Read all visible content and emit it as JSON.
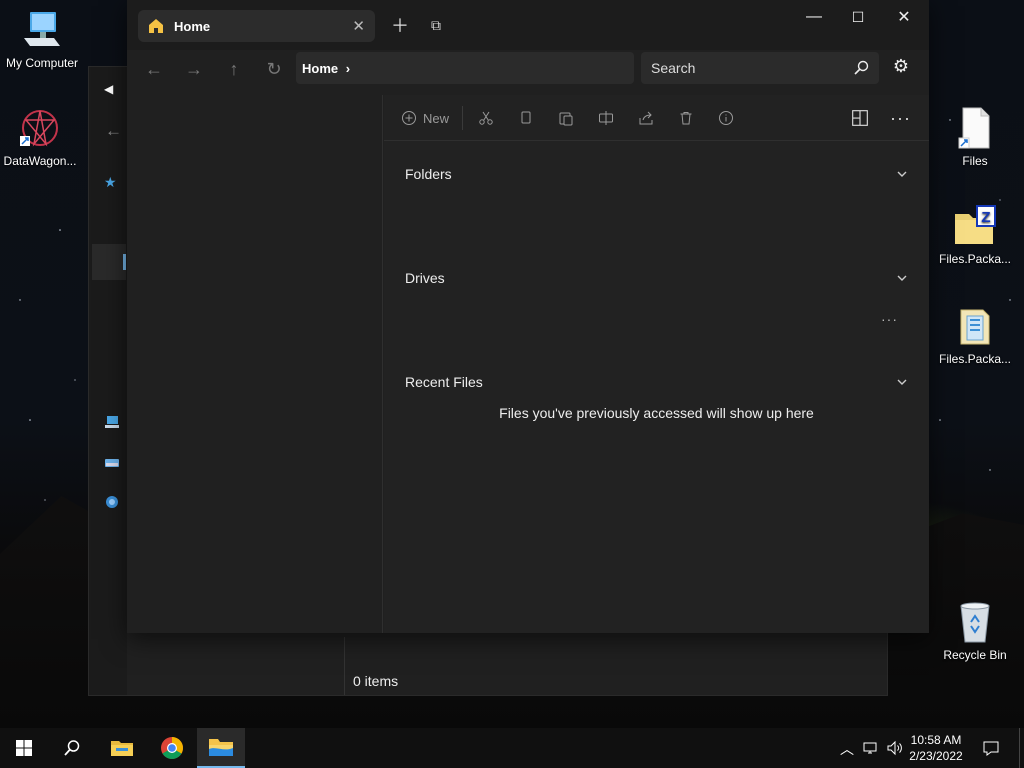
{
  "desktop": {
    "icons_left": [
      {
        "label": "My Computer",
        "icon": "computer-icon"
      },
      {
        "label": "DataWagon...",
        "icon": "datawagon-icon"
      }
    ],
    "icons_right": [
      {
        "label": "Files",
        "icon": "file-shortcut-icon"
      },
      {
        "label": "Files.Packa...",
        "icon": "zip-folder-icon"
      },
      {
        "label": "Files.Packa...",
        "icon": "package-icon"
      },
      {
        "label": "Recycle Bin",
        "icon": "recycle-bin-icon"
      }
    ]
  },
  "background_window": {
    "status_text": "0 items"
  },
  "window": {
    "tab": {
      "title": "Home",
      "icon": "home-icon"
    },
    "address": {
      "path": "Home"
    },
    "search": {
      "placeholder": "Search"
    },
    "toolbar": {
      "new_label": "New"
    },
    "sections": [
      {
        "title": "Folders"
      },
      {
        "title": "Drives"
      },
      {
        "title": "Recent Files"
      }
    ],
    "recent_empty_message": "Files you've previously accessed will show up here",
    "drives_more": "···"
  },
  "taskbar": {
    "time": "10:58 AM",
    "date": "2/23/2022"
  },
  "colors": {
    "window_bg": "#202020",
    "titlebar_bg": "#1c1c1c",
    "accent": "#76b9ed",
    "home_icon": "#f5c244"
  }
}
